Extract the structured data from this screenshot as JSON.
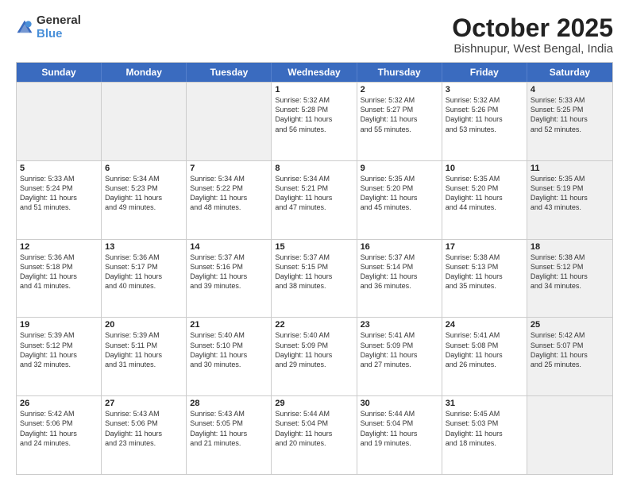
{
  "header": {
    "logo_general": "General",
    "logo_blue": "Blue",
    "title": "October 2025",
    "location": "Bishnupur, West Bengal, India"
  },
  "days_of_week": [
    "Sunday",
    "Monday",
    "Tuesday",
    "Wednesday",
    "Thursday",
    "Friday",
    "Saturday"
  ],
  "weeks": [
    [
      {
        "day": "",
        "info": "",
        "shaded": true
      },
      {
        "day": "",
        "info": "",
        "shaded": true
      },
      {
        "day": "",
        "info": "",
        "shaded": true
      },
      {
        "day": "1",
        "info": "Sunrise: 5:32 AM\nSunset: 5:28 PM\nDaylight: 11 hours\nand 56 minutes.",
        "shaded": false
      },
      {
        "day": "2",
        "info": "Sunrise: 5:32 AM\nSunset: 5:27 PM\nDaylight: 11 hours\nand 55 minutes.",
        "shaded": false
      },
      {
        "day": "3",
        "info": "Sunrise: 5:32 AM\nSunset: 5:26 PM\nDaylight: 11 hours\nand 53 minutes.",
        "shaded": false
      },
      {
        "day": "4",
        "info": "Sunrise: 5:33 AM\nSunset: 5:25 PM\nDaylight: 11 hours\nand 52 minutes.",
        "shaded": true
      }
    ],
    [
      {
        "day": "5",
        "info": "Sunrise: 5:33 AM\nSunset: 5:24 PM\nDaylight: 11 hours\nand 51 minutes.",
        "shaded": false
      },
      {
        "day": "6",
        "info": "Sunrise: 5:34 AM\nSunset: 5:23 PM\nDaylight: 11 hours\nand 49 minutes.",
        "shaded": false
      },
      {
        "day": "7",
        "info": "Sunrise: 5:34 AM\nSunset: 5:22 PM\nDaylight: 11 hours\nand 48 minutes.",
        "shaded": false
      },
      {
        "day": "8",
        "info": "Sunrise: 5:34 AM\nSunset: 5:21 PM\nDaylight: 11 hours\nand 47 minutes.",
        "shaded": false
      },
      {
        "day": "9",
        "info": "Sunrise: 5:35 AM\nSunset: 5:20 PM\nDaylight: 11 hours\nand 45 minutes.",
        "shaded": false
      },
      {
        "day": "10",
        "info": "Sunrise: 5:35 AM\nSunset: 5:20 PM\nDaylight: 11 hours\nand 44 minutes.",
        "shaded": false
      },
      {
        "day": "11",
        "info": "Sunrise: 5:35 AM\nSunset: 5:19 PM\nDaylight: 11 hours\nand 43 minutes.",
        "shaded": true
      }
    ],
    [
      {
        "day": "12",
        "info": "Sunrise: 5:36 AM\nSunset: 5:18 PM\nDaylight: 11 hours\nand 41 minutes.",
        "shaded": false
      },
      {
        "day": "13",
        "info": "Sunrise: 5:36 AM\nSunset: 5:17 PM\nDaylight: 11 hours\nand 40 minutes.",
        "shaded": false
      },
      {
        "day": "14",
        "info": "Sunrise: 5:37 AM\nSunset: 5:16 PM\nDaylight: 11 hours\nand 39 minutes.",
        "shaded": false
      },
      {
        "day": "15",
        "info": "Sunrise: 5:37 AM\nSunset: 5:15 PM\nDaylight: 11 hours\nand 38 minutes.",
        "shaded": false
      },
      {
        "day": "16",
        "info": "Sunrise: 5:37 AM\nSunset: 5:14 PM\nDaylight: 11 hours\nand 36 minutes.",
        "shaded": false
      },
      {
        "day": "17",
        "info": "Sunrise: 5:38 AM\nSunset: 5:13 PM\nDaylight: 11 hours\nand 35 minutes.",
        "shaded": false
      },
      {
        "day": "18",
        "info": "Sunrise: 5:38 AM\nSunset: 5:12 PM\nDaylight: 11 hours\nand 34 minutes.",
        "shaded": true
      }
    ],
    [
      {
        "day": "19",
        "info": "Sunrise: 5:39 AM\nSunset: 5:12 PM\nDaylight: 11 hours\nand 32 minutes.",
        "shaded": false
      },
      {
        "day": "20",
        "info": "Sunrise: 5:39 AM\nSunset: 5:11 PM\nDaylight: 11 hours\nand 31 minutes.",
        "shaded": false
      },
      {
        "day": "21",
        "info": "Sunrise: 5:40 AM\nSunset: 5:10 PM\nDaylight: 11 hours\nand 30 minutes.",
        "shaded": false
      },
      {
        "day": "22",
        "info": "Sunrise: 5:40 AM\nSunset: 5:09 PM\nDaylight: 11 hours\nand 29 minutes.",
        "shaded": false
      },
      {
        "day": "23",
        "info": "Sunrise: 5:41 AM\nSunset: 5:09 PM\nDaylight: 11 hours\nand 27 minutes.",
        "shaded": false
      },
      {
        "day": "24",
        "info": "Sunrise: 5:41 AM\nSunset: 5:08 PM\nDaylight: 11 hours\nand 26 minutes.",
        "shaded": false
      },
      {
        "day": "25",
        "info": "Sunrise: 5:42 AM\nSunset: 5:07 PM\nDaylight: 11 hours\nand 25 minutes.",
        "shaded": true
      }
    ],
    [
      {
        "day": "26",
        "info": "Sunrise: 5:42 AM\nSunset: 5:06 PM\nDaylight: 11 hours\nand 24 minutes.",
        "shaded": false
      },
      {
        "day": "27",
        "info": "Sunrise: 5:43 AM\nSunset: 5:06 PM\nDaylight: 11 hours\nand 23 minutes.",
        "shaded": false
      },
      {
        "day": "28",
        "info": "Sunrise: 5:43 AM\nSunset: 5:05 PM\nDaylight: 11 hours\nand 21 minutes.",
        "shaded": false
      },
      {
        "day": "29",
        "info": "Sunrise: 5:44 AM\nSunset: 5:04 PM\nDaylight: 11 hours\nand 20 minutes.",
        "shaded": false
      },
      {
        "day": "30",
        "info": "Sunrise: 5:44 AM\nSunset: 5:04 PM\nDaylight: 11 hours\nand 19 minutes.",
        "shaded": false
      },
      {
        "day": "31",
        "info": "Sunrise: 5:45 AM\nSunset: 5:03 PM\nDaylight: 11 hours\nand 18 minutes.",
        "shaded": false
      },
      {
        "day": "",
        "info": "",
        "shaded": true
      }
    ]
  ]
}
